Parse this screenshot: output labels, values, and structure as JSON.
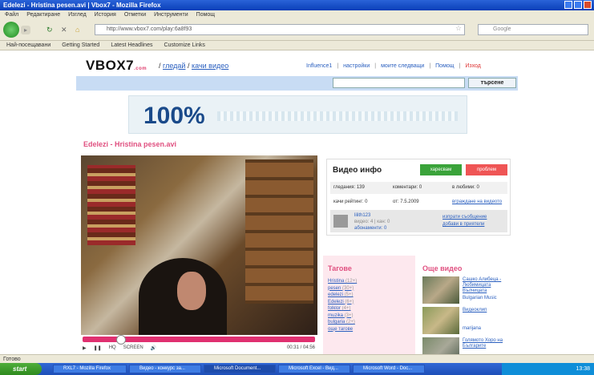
{
  "window": {
    "title": "Edelezi - Hristina pesen.avi | Vbox7 - Mozilla Firefox"
  },
  "menubar": [
    "Файл",
    "Редактиране",
    "Изглед",
    "История",
    "Отметки",
    "Инструменти",
    "Помощ"
  ],
  "browser": {
    "url": "http://www.vbox7.com/play:6a8f93",
    "search_placeholder": "Google"
  },
  "bookmarks": [
    "Най-посещавани",
    "Getting Started",
    "Latest Headlines",
    "Customize Links"
  ],
  "site": {
    "logo": "VBOX7",
    "logo_suffix": ".com",
    "crumbs": {
      "sep1": "/",
      "link1": "гледай",
      "sep2": "/",
      "link2": "качи видео"
    },
    "toplinks": [
      "Influence1",
      "настройки",
      "моите следващи",
      "Помощ",
      "Изход"
    ],
    "search_value": "",
    "search_btn": "търсене",
    "banner_pct": "100%"
  },
  "video": {
    "title": "Edelezi - Hristina pesen.avi",
    "time": "00:31 / 04:56",
    "progress": 0.15,
    "controls": [
      "play",
      "pause",
      "HQ",
      "SCREEN",
      "vol"
    ]
  },
  "info": {
    "heading": "Видео инфо",
    "btn_green": "харесвам",
    "btn_red": "проблем",
    "row1": {
      "a": "гледания: 139",
      "b": "коментари: 0",
      "c": "в любими: 0"
    },
    "row2": {
      "a": "качи рейтинг: 0",
      "b": "от: 7.5.2009",
      "c": "вграждане на видеото"
    },
    "uploader": {
      "name": "lilith123",
      "meta": "видео: 4  |  кан: 0",
      "link3": "абонаменти: 0",
      "right1": "изпрати съобщение",
      "right2": "добави в приятели"
    }
  },
  "tags": {
    "heading": "Тагове",
    "items": [
      {
        "tag": "Hristina",
        "count": "(12+)"
      },
      {
        "tag": "pesen",
        "count": "(30+)"
      },
      {
        "tag": "edelezi",
        "count": "(5+)"
      },
      {
        "tag": "Edelezi",
        "count": "(6+)"
      },
      {
        "tag": "folklor",
        "count": "(4+)"
      },
      {
        "tag": "muzika",
        "count": "(3+)"
      },
      {
        "tag": "bulgaria",
        "count": "(2+)"
      },
      {
        "tag": "още тагове",
        "count": ""
      }
    ]
  },
  "more": {
    "heading": "Още видео",
    "items": [
      {
        "title": "Сашко Алибеца - Любимицата Вълчицата",
        "user": "Bulgarian Music"
      },
      {
        "title": "Видеоклип",
        "user": "marijana"
      },
      {
        "title": "Голямото Хоро на Българите",
        "user": ""
      }
    ]
  },
  "status": "Готово",
  "taskbar": {
    "start": "start",
    "tasks": [
      "RXL7 - Mozilla Firefox",
      "Видео - конкурс за...",
      "Microsoft Document...",
      "Microsoft Excel - Вид...",
      "Microsoft Word - Doc..."
    ],
    "tray_time": "13:38"
  }
}
